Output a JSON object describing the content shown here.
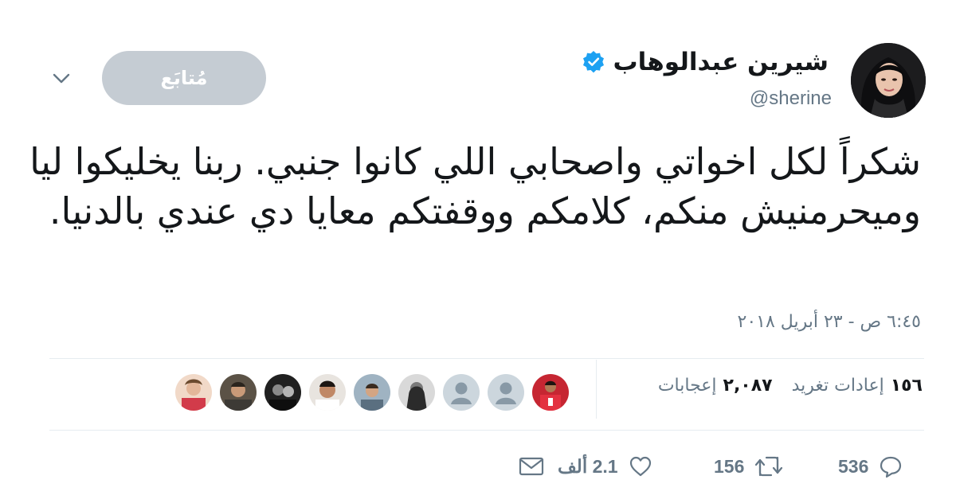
{
  "author": {
    "name": "شيرين عبدالوهاب",
    "handle": "@sherine",
    "verified": true
  },
  "follow_label": "مُتابَع",
  "tweet": {
    "text": "شكراً لكل اخواتي واصحابي اللي كانوا جنبي. ربنا يخليكوا ليا وميحرمنيش منكم، كلامكم ووقفتكم معايا دي عندي بالدنيا.",
    "timestamp": "٦:٤٥ ص - ٢٣ أبريل ٢٠١٨"
  },
  "stats": {
    "retweets_count": "١٥٦",
    "retweets_label": "إعادات تغريد",
    "likes_count": "٢,٠٨٧",
    "likes_label": "إعجابات"
  },
  "actions": {
    "reply_count": "536",
    "retweet_count": "156",
    "like_count": "2.1 ألف"
  },
  "colors": {
    "verified": "#1da1f2",
    "follow_bg": "#c5ccd3",
    "muted": "#657786"
  },
  "icons": [
    "verified-badge-icon",
    "chevron-down-icon",
    "reply-icon",
    "retweet-icon",
    "like-icon",
    "message-icon",
    "default-avatar-icon"
  ]
}
